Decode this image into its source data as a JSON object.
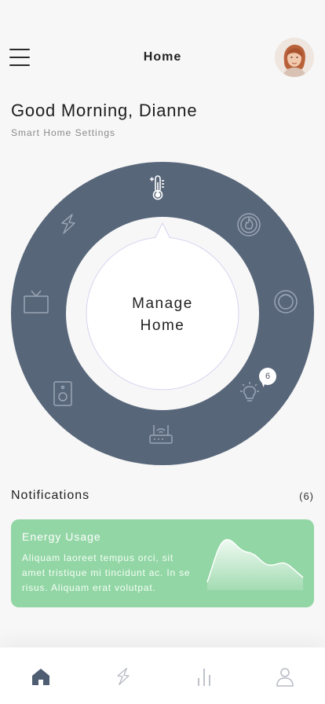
{
  "header": {
    "title": "Home",
    "menu_icon": "hamburger-menu-icon",
    "avatar": "user-avatar"
  },
  "greeting": "Good Morning, Dianne",
  "subtitle": "Smart Home Settings",
  "dial": {
    "center_line1": "Manage",
    "center_line2": "Home",
    "devices": [
      {
        "name": "thermostat",
        "icon": "thermometer-icon",
        "selected": true
      },
      {
        "name": "heating",
        "icon": "flame-icon",
        "selected": false
      },
      {
        "name": "robot-vacuum",
        "icon": "robot-vacuum-icon",
        "selected": false
      },
      {
        "name": "lights",
        "icon": "lightbulb-icon",
        "selected": false,
        "badge": "6"
      },
      {
        "name": "router",
        "icon": "wifi-router-icon",
        "selected": false
      },
      {
        "name": "speaker",
        "icon": "speaker-icon",
        "selected": false
      },
      {
        "name": "tv",
        "icon": "tv-icon",
        "selected": false
      },
      {
        "name": "energy",
        "icon": "lightning-icon",
        "selected": false
      }
    ]
  },
  "notifications": {
    "title": "Notifications",
    "count": "(6)",
    "card": {
      "title": "Energy Usage",
      "text": "Aliquam laoreet tempus orci, sit amet tristique mi tincidunt ac. In se risus. Aliquam erat volutpat."
    }
  },
  "bottom_nav": [
    {
      "name": "home",
      "icon": "home-icon",
      "active": true
    },
    {
      "name": "energy",
      "icon": "lightning-icon",
      "active": false
    },
    {
      "name": "stats",
      "icon": "bar-chart-icon",
      "active": false
    },
    {
      "name": "profile",
      "icon": "user-icon",
      "active": false
    }
  ],
  "colors": {
    "dial_ring": "#58667a",
    "accent_green": "#93d6a5",
    "background": "#f7f7f7",
    "nav_active": "#4f5d73",
    "nav_inactive": "#b8bcc4"
  }
}
